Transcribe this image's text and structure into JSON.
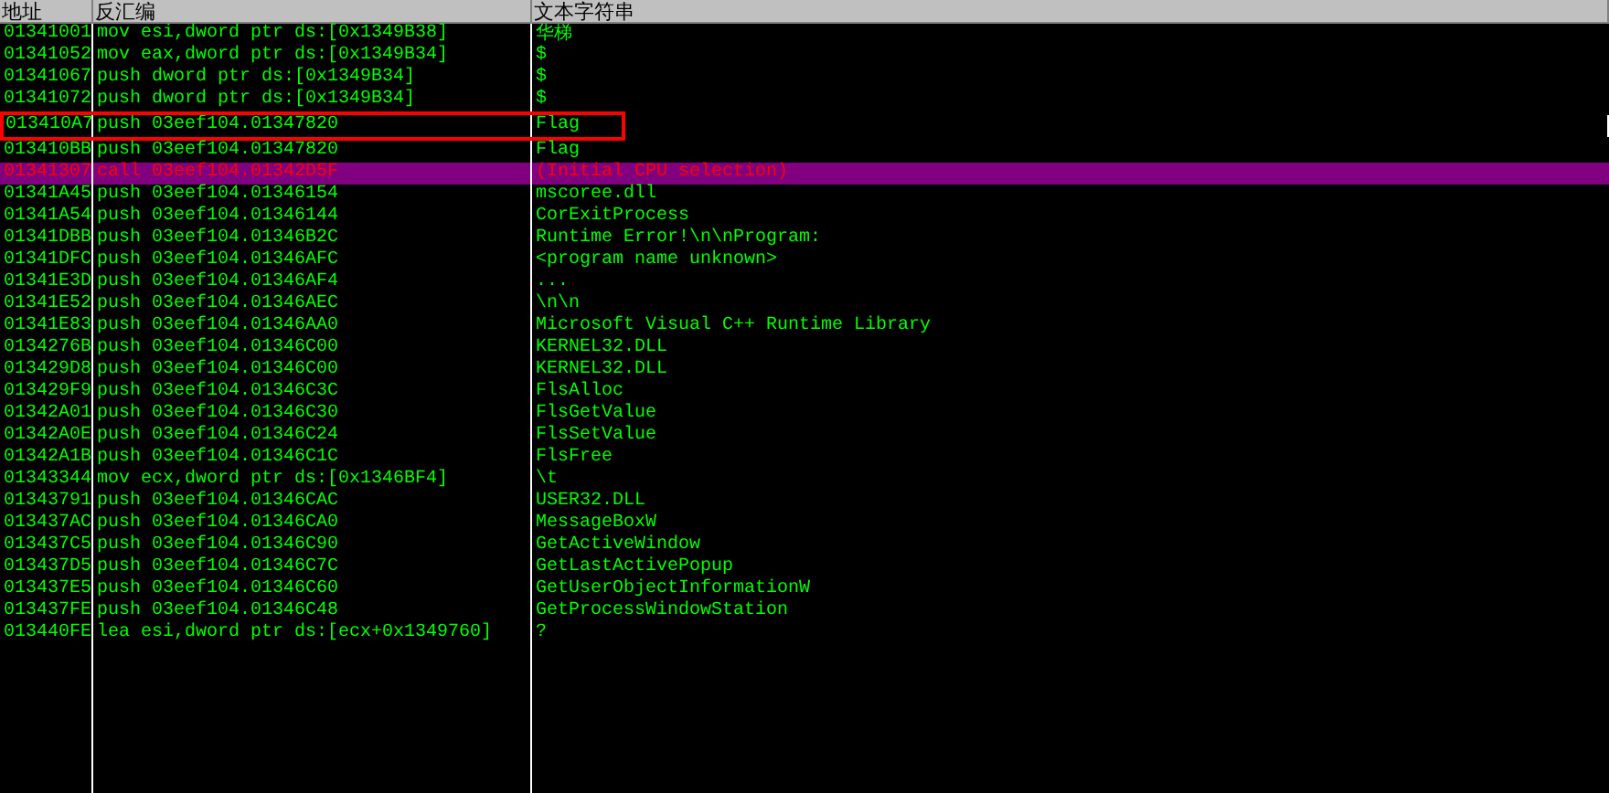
{
  "columns": [
    "地址",
    "反汇编",
    "文本字符串"
  ],
  "rows": [
    {
      "address": "01341001",
      "disassembly": "mov esi,dword ptr ds:[0x1349B38]",
      "text": "华梯",
      "selected": false,
      "marked": false
    },
    {
      "address": "01341052",
      "disassembly": "mov eax,dword ptr ds:[0x1349B34]",
      "text": "$",
      "selected": false,
      "marked": false
    },
    {
      "address": "01341067",
      "disassembly": "push dword ptr ds:[0x1349B34]",
      "text": "$",
      "selected": false,
      "marked": false
    },
    {
      "address": "01341072",
      "disassembly": "push dword ptr ds:[0x1349B34]",
      "text": "$",
      "selected": false,
      "marked": false
    },
    {
      "address": "013410A7",
      "disassembly": "push 03eef104.01347820",
      "text": "Flag",
      "selected": false,
      "marked": true
    },
    {
      "address": "013410BB",
      "disassembly": "push 03eef104.01347820",
      "text": "Flag",
      "selected": false,
      "marked": false
    },
    {
      "address": "01341307",
      "disassembly": "call 03eef104.01342D5F",
      "text": "(Initial CPU selection)",
      "selected": true,
      "marked": false
    },
    {
      "address": "01341A45",
      "disassembly": "push 03eef104.01346154",
      "text": "mscoree.dll",
      "selected": false,
      "marked": false
    },
    {
      "address": "01341A54",
      "disassembly": "push 03eef104.01346144",
      "text": "CorExitProcess",
      "selected": false,
      "marked": false
    },
    {
      "address": "01341DBB",
      "disassembly": "push 03eef104.01346B2C",
      "text": "Runtime Error!\\n\\nProgram:",
      "selected": false,
      "marked": false
    },
    {
      "address": "01341DFC",
      "disassembly": "push 03eef104.01346AFC",
      "text": "<program name unknown>",
      "selected": false,
      "marked": false
    },
    {
      "address": "01341E3D",
      "disassembly": "push 03eef104.01346AF4",
      "text": "...",
      "selected": false,
      "marked": false
    },
    {
      "address": "01341E52",
      "disassembly": "push 03eef104.01346AEC",
      "text": "\\n\\n",
      "selected": false,
      "marked": false
    },
    {
      "address": "01341E83",
      "disassembly": "push 03eef104.01346AA0",
      "text": "Microsoft Visual C++ Runtime Library",
      "selected": false,
      "marked": false
    },
    {
      "address": "0134276B",
      "disassembly": "push 03eef104.01346C00",
      "text": "KERNEL32.DLL",
      "selected": false,
      "marked": false
    },
    {
      "address": "013429D8",
      "disassembly": "push 03eef104.01346C00",
      "text": "KERNEL32.DLL",
      "selected": false,
      "marked": false
    },
    {
      "address": "013429F9",
      "disassembly": "push 03eef104.01346C3C",
      "text": "FlsAlloc",
      "selected": false,
      "marked": false
    },
    {
      "address": "01342A01",
      "disassembly": "push 03eef104.01346C30",
      "text": "FlsGetValue",
      "selected": false,
      "marked": false
    },
    {
      "address": "01342A0E",
      "disassembly": "push 03eef104.01346C24",
      "text": "FlsSetValue",
      "selected": false,
      "marked": false
    },
    {
      "address": "01342A1B",
      "disassembly": "push 03eef104.01346C1C",
      "text": "FlsFree",
      "selected": false,
      "marked": false
    },
    {
      "address": "01343344",
      "disassembly": "mov ecx,dword ptr ds:[0x1346BF4]",
      "text": "\\t",
      "selected": false,
      "marked": false
    },
    {
      "address": "01343791",
      "disassembly": "push 03eef104.01346CAC",
      "text": "USER32.DLL",
      "selected": false,
      "marked": false
    },
    {
      "address": "013437AC",
      "disassembly": "push 03eef104.01346CA0",
      "text": "MessageBoxW",
      "selected": false,
      "marked": false
    },
    {
      "address": "013437C5",
      "disassembly": "push 03eef104.01346C90",
      "text": "GetActiveWindow",
      "selected": false,
      "marked": false
    },
    {
      "address": "013437D5",
      "disassembly": "push 03eef104.01346C7C",
      "text": "GetLastActivePopup",
      "selected": false,
      "marked": false
    },
    {
      "address": "013437E5",
      "disassembly": "push 03eef104.01346C60",
      "text": "GetUserObjectInformationW",
      "selected": false,
      "marked": false
    },
    {
      "address": "013437FE",
      "disassembly": "push 03eef104.01346C48",
      "text": "GetProcessWindowStation",
      "selected": false,
      "marked": false
    },
    {
      "address": "013440FE",
      "disassembly": "lea esi,dword ptr ds:[ecx+0x1349760]",
      "text": "?",
      "selected": false,
      "marked": false
    }
  ]
}
